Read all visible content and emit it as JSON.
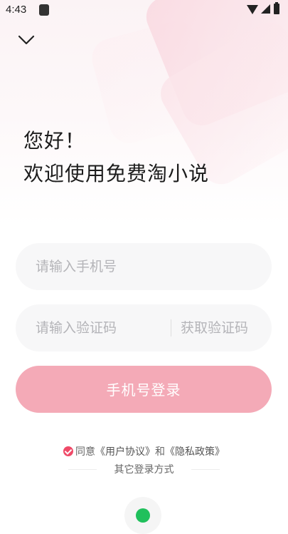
{
  "status_bar": {
    "time": "4:43",
    "icons": [
      "notification-icon",
      "wifi-icon",
      "signal-icon",
      "battery-icon"
    ]
  },
  "nav": {
    "back_icon": "chevron-down-icon"
  },
  "greeting": {
    "line1": "您好！",
    "line2": "欢迎使用免费淘小说"
  },
  "phone_field": {
    "placeholder": "请输入手机号",
    "value": ""
  },
  "code_field": {
    "placeholder": "请输入验证码",
    "value": "",
    "get_code_label": "获取验证码"
  },
  "login_button": {
    "label": "手机号登录"
  },
  "agreement": {
    "checked": true,
    "prefix": "同意",
    "user_agreement": "《用户协议》",
    "conjunction": "和",
    "privacy_policy": "《隐私政策》"
  },
  "other_login": {
    "label": "其它登录方式",
    "providers": [
      "wechat-icon"
    ]
  },
  "colors": {
    "accent": "#ef4a68",
    "login_button_bg": "#f4aab7",
    "field_bg": "#f7f7f8",
    "placeholder": "#b4b4b8",
    "wechat": "#20c05c"
  }
}
